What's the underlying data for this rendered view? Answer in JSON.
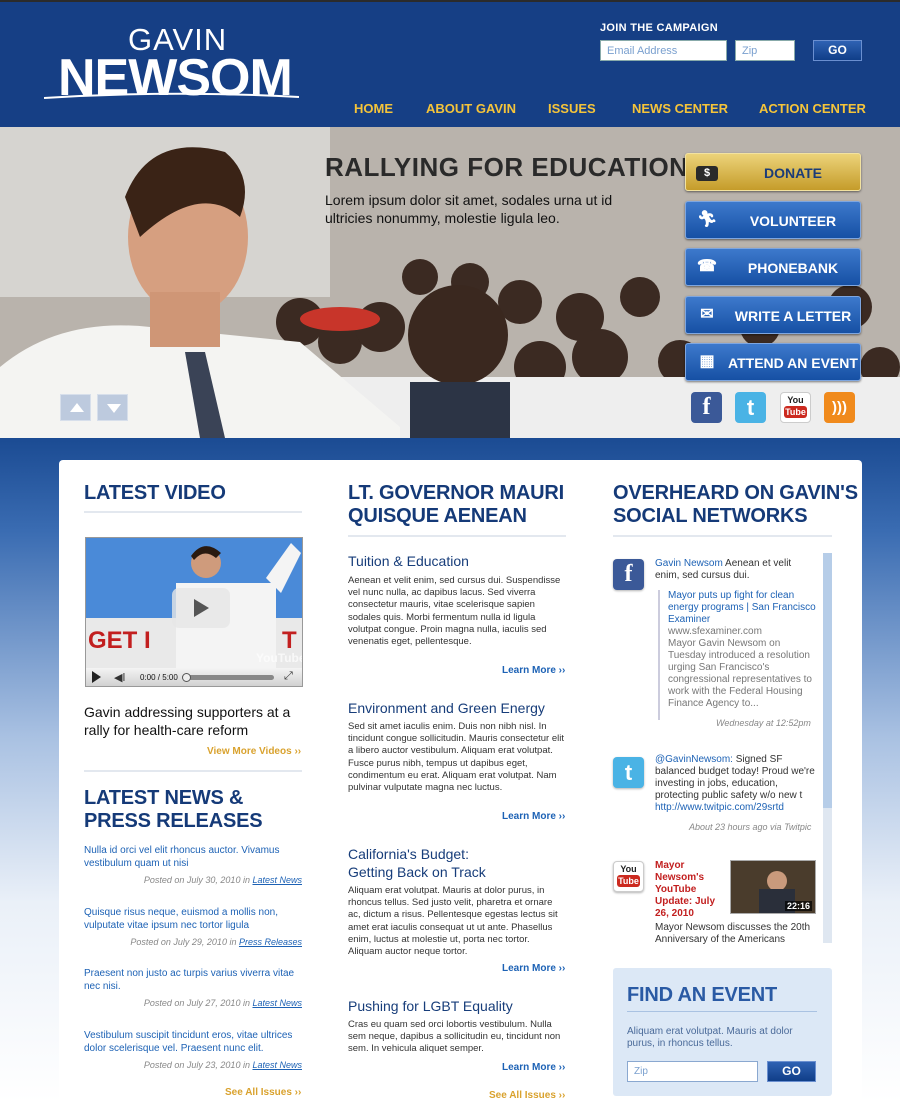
{
  "header": {
    "logo_line1": "GAVIN",
    "logo_line2": "NEWSOM",
    "join_label": "JOIN THE CAMPAIGN",
    "email_placeholder": "Email Address",
    "zip_placeholder": "Zip",
    "go_label": "GO",
    "nav": [
      "HOME",
      "ABOUT GAVIN",
      "ISSUES",
      "NEWS CENTER",
      "ACTION CENTER"
    ]
  },
  "hero": {
    "title": "RALLYING FOR EDUCATION",
    "title_arrow": "»",
    "subtitle": "Lorem ipsum dolor sit amet, sodales urna ut id ultricies nonummy, molestie ligula leo.",
    "actions": [
      {
        "label": "DONATE",
        "icon": "dollar-icon"
      },
      {
        "label": "VOLUNTEER",
        "icon": "runner-icon"
      },
      {
        "label": "PHONEBANK",
        "icon": "phone-icon"
      },
      {
        "label": "WRITE A LETTER",
        "icon": "envelope-icon"
      },
      {
        "label": "ATTEND AN EVENT",
        "icon": "calendar-icon"
      }
    ],
    "social": [
      {
        "name": "facebook-icon",
        "glyph": "f",
        "color": "#3b5998"
      },
      {
        "name": "twitter-icon",
        "glyph": "t",
        "color": "#4ab3e5"
      },
      {
        "name": "youtube-icon",
        "glyph": "You\nTube",
        "color": "#cc2a1f"
      },
      {
        "name": "rss-icon",
        "glyph": "))",
        "color": "#f08a1c"
      }
    ]
  },
  "video": {
    "heading": "LATEST VIDEO",
    "time": "0:00 / 5:00",
    "caption": "Gavin addressing supporters at a rally for health-care reform",
    "more": "View More Videos ››"
  },
  "news": {
    "heading_line1": "LATEST NEWS &",
    "heading_line2": "PRESS RELEASES",
    "items": [
      {
        "title": "Nulla id orci vel elit rhoncus auctor. Vivamus vestibulum quam ut nisi",
        "date": "Posted on July 30, 2010 in",
        "cat": "Latest News"
      },
      {
        "title": "Quisque risus neque, euismod a mollis non, vulputate vitae ipsum nec tortor ligula",
        "date": "Posted on July 29, 2010 in",
        "cat": "Press Releases"
      },
      {
        "title": "Praesent non justo ac turpis varius viverra vitae nec nisi.",
        "date": "Posted on July 27, 2010 in",
        "cat": "Latest News"
      },
      {
        "title": "Vestibulum suscipit tincidunt eros, vitae ultrices dolor scelerisque vel. Praesent nunc elit.",
        "date": "Posted on July 23, 2010 in",
        "cat": "Latest News"
      }
    ],
    "more": "See All Issues ››"
  },
  "issues": {
    "heading_line1": "LT. GOVERNOR MAURI",
    "heading_line2": "QUISQUE AENEAN",
    "articles": [
      {
        "title": "Tuition & Education",
        "body": "Aenean et velit enim, sed cursus dui. Suspendisse vel nunc nulla, ac dapibus lacus. Sed viverra consectetur mauris, vitae scelerisque sapien sodales quis. Morbi fermentum nulla id ligula volutpat congue. Proin magna nulla, iaculis sed venenatis eget, pellentesque.",
        "more": "Learn More ››"
      },
      {
        "title": "Environment and Green Energy",
        "body": "Sed sit amet iaculis enim. Duis non nibh nisl. In tincidunt congue sollicitudin. Mauris consectetur elit a libero auctor vestibulum. Aliquam erat volutpat. Fusce purus nibh, tempus ut dapibus eget, condimentum eu erat. Aliquam erat volutpat. Nam pulvinar vulputate magna nec luctus.",
        "more": "Learn More ››"
      },
      {
        "title": "California's Budget:",
        "title2": "Getting Back on Track",
        "body": "Aliquam erat volutpat. Mauris at dolor purus, in rhoncus tellus. Sed justo velit, pharetra et ornare ac, dictum a risus. Pellentesque egestas lectus sit amet erat iaculis consequat ut ut ante. Phasellus enim, luctus at molestie ut, porta nec tortor. Aliquam auctor neque tortor.",
        "more": "Learn More ››"
      },
      {
        "title": "Pushing for LGBT Equality",
        "body": "Cras eu quam sed orci lobortis vestibulum. Nulla sem neque, dapibus a sollicitudin eu, tincidunt non sem. In vehicula aliquet semper.",
        "more": "Learn More ››"
      }
    ],
    "more": "See All Issues ››"
  },
  "social": {
    "heading_line1": "OVERHEARD ON GAVIN'S",
    "heading_line2": "SOCIAL NETWORKS",
    "fb": {
      "author": "Gavin Newsom",
      "text": " Aenean et velit enim, sed cursus dui.",
      "link_title": "Mayor puts up fight for clean energy programs | San Francisco Examiner",
      "link_url": "www.sfexaminer.com",
      "link_body": "Mayor Gavin Newsom on Tuesday introduced a resolution urging San Francisco's congressional representatives to work with the Federal Housing Finance Agency to...",
      "time": "Wednesday at 12:52pm"
    },
    "tw": {
      "author": "@GavinNewsom:",
      "text": " Signed SF balanced budget today! Proud we're investing in jobs, education, protecting public safety w/o new t",
      "link": "http://www.twitpic.com/29srtd",
      "time": "About 23 hours ago via Twitpic"
    },
    "yt": {
      "title": "Mayor Newsom's YouTube Update: July 26, 2010",
      "duration": "22:16",
      "body": "Mayor Newsom discusses the 20th Anniversary of the Americans"
    }
  },
  "find_event": {
    "heading": "FIND AN EVENT",
    "text": "Aliquam erat volutpat. Mauris at dolor purus, in rhoncus tellus.",
    "zip_placeholder": "Zip",
    "go_label": "GO"
  },
  "colors": {
    "navy": "#163f85",
    "gold": "#f5c43a",
    "link": "#1d62b5",
    "heading": "#153a78"
  }
}
